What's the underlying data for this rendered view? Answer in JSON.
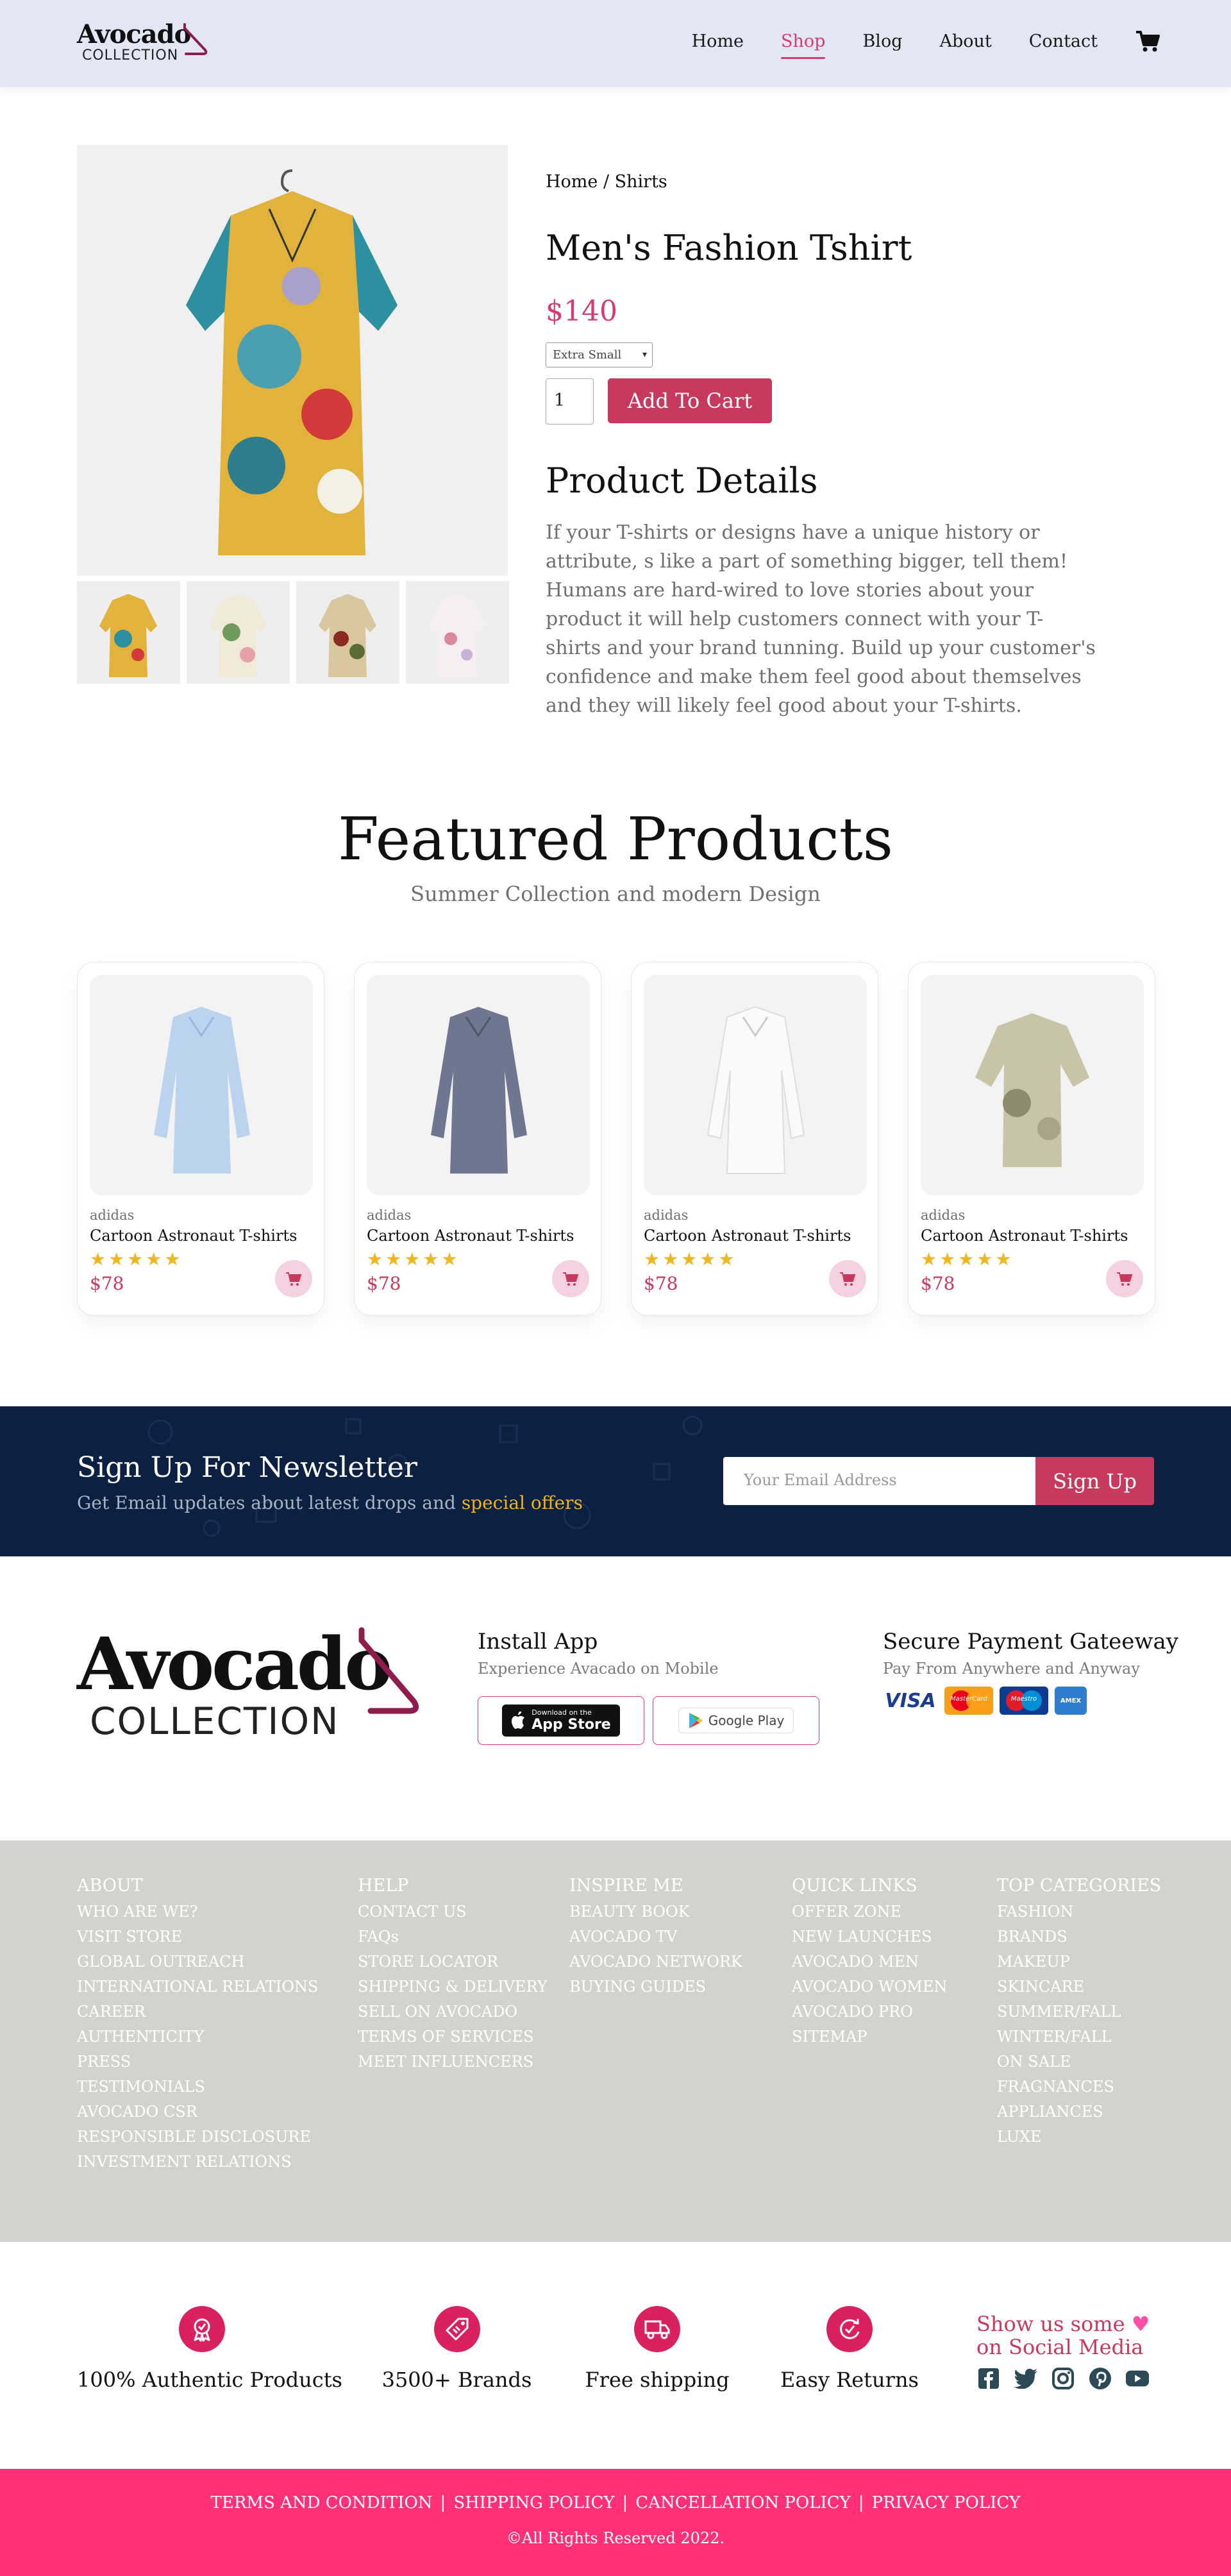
{
  "nav": {
    "logo_top": "Avocado",
    "logo_bottom": "COLLECTION",
    "links": [
      "Home",
      "Shop",
      "Blog",
      "About",
      "Contact"
    ],
    "active": "Shop",
    "cart_icon": "cart-icon"
  },
  "product": {
    "breadcrumb": "Home / Shirts",
    "title": "Men's Fashion Tshirt",
    "price": "$140",
    "size_selected": "Extra Small",
    "quantity": "1",
    "add_to_cart": "Add To Cart",
    "details_heading": "Product Details",
    "details_text": "If your T-shirts or designs have a unique history or attribute, s like a part of something bigger, tell them! Humans are hard-wired to love stories about your product it will help customers connect with your T-shirts and your brand tunning. Build up your customer's confidence and make them feel good about themselves and they will likely feel good about your T-shirts."
  },
  "featured": {
    "heading": "Featured Products",
    "subheading": "Summer Collection and modern Design",
    "items": [
      {
        "brand": "adidas",
        "name": "Cartoon Astronaut T-shirts",
        "price": "$78",
        "rating": 5
      },
      {
        "brand": "adidas",
        "name": "Cartoon Astronaut T-shirts",
        "price": "$78",
        "rating": 5
      },
      {
        "brand": "adidas",
        "name": "Cartoon Astronaut T-shirts",
        "price": "$78",
        "rating": 5
      },
      {
        "brand": "adidas",
        "name": "Cartoon Astronaut T-shirts",
        "price": "$78",
        "rating": 5
      }
    ]
  },
  "newsletter": {
    "heading": "Sign Up For Newsletter",
    "text": "Get Email updates about latest drops and ",
    "highlight": "special offers",
    "placeholder": "Your Email Address",
    "button": "Sign Up"
  },
  "footer_top": {
    "logo_top": "Avocado",
    "logo_bottom": "COLLECTION",
    "app_heading": "Install App",
    "app_text": "Experience Avacado on Mobile",
    "app_store_small": "Download on the",
    "app_store": "App Store",
    "google_play": "Google Play",
    "pay_heading": "Secure Payment Gateeway",
    "pay_text": "Pay From Anywhere and Anyway",
    "pay_cards": [
      "VISA",
      "MasterCard",
      "Maestro",
      "AMEX"
    ]
  },
  "footer_links": [
    {
      "heading": "ABOUT",
      "items": [
        "WHO ARE WE?",
        "VISIT STORE",
        "GLOBAL OUTREACH",
        "INTERNATIONAL RELATIONS",
        "CAREER",
        "AUTHENTICITY",
        "PRESS",
        "TESTIMONIALS",
        "AVOCADO CSR",
        "RESPONSIBLE DISCLOSURE",
        "INVESTMENT RELATIONS"
      ]
    },
    {
      "heading": "HELP",
      "items": [
        "CONTACT US",
        "FAQs",
        "STORE LOCATOR",
        "SHIPPING & DELIVERY",
        "SELL ON AVOCADO",
        "TERMS OF SERVICES",
        "MEET INFLUENCERS"
      ]
    },
    {
      "heading": "INSPIRE ME",
      "items": [
        "BEAUTY BOOK",
        "AVOCADO TV",
        "AVOCADO NETWORK",
        "BUYING GUIDES"
      ]
    },
    {
      "heading": "QUICK LINKS",
      "items": [
        "OFFER ZONE",
        "NEW LAUNCHES",
        "AVOCADO MEN",
        "AVOCADO WOMEN",
        "AVOCADO PRO",
        "SITEMAP"
      ]
    },
    {
      "heading": "TOP CATEGORIES",
      "items": [
        "FASHION",
        "BRANDS",
        "MAKEUP",
        "SKINCARE",
        "SUMMER/FALL",
        "WINTER/FALL",
        "ON SALE",
        "FRAGNANCES",
        "APPLIANCES",
        "LUXE"
      ]
    }
  ],
  "features": [
    {
      "label": "100% Authentic Products",
      "icon": "authentic-badge-icon"
    },
    {
      "label": "3500+ Brands",
      "icon": "tag-icon"
    },
    {
      "label": "Free shipping",
      "icon": "truck-icon"
    },
    {
      "label": "Easy Returns",
      "icon": "return-icon"
    }
  ],
  "social": {
    "heading_line1": "Show us some",
    "heading_line2": "on Social Media",
    "icons": [
      "facebook-icon",
      "twitter-icon",
      "instagram-icon",
      "pinterest-icon",
      "youtube-icon"
    ]
  },
  "bottom": {
    "links": [
      "TERMS AND CONDITION",
      "SHIPPING POLICY",
      "CANCELLATION POLICY",
      "PRIVACY POLICY"
    ],
    "copyright": "©All Rights Reserved 2022."
  },
  "colors": {
    "accent": "#c8395e",
    "nav_bg": "#e3e6f3",
    "newsletter_bg": "#0c2041",
    "footer_links_bg": "#d3d3ce",
    "bottom_bar": "#ff2f78",
    "star": "#f3b51c"
  }
}
